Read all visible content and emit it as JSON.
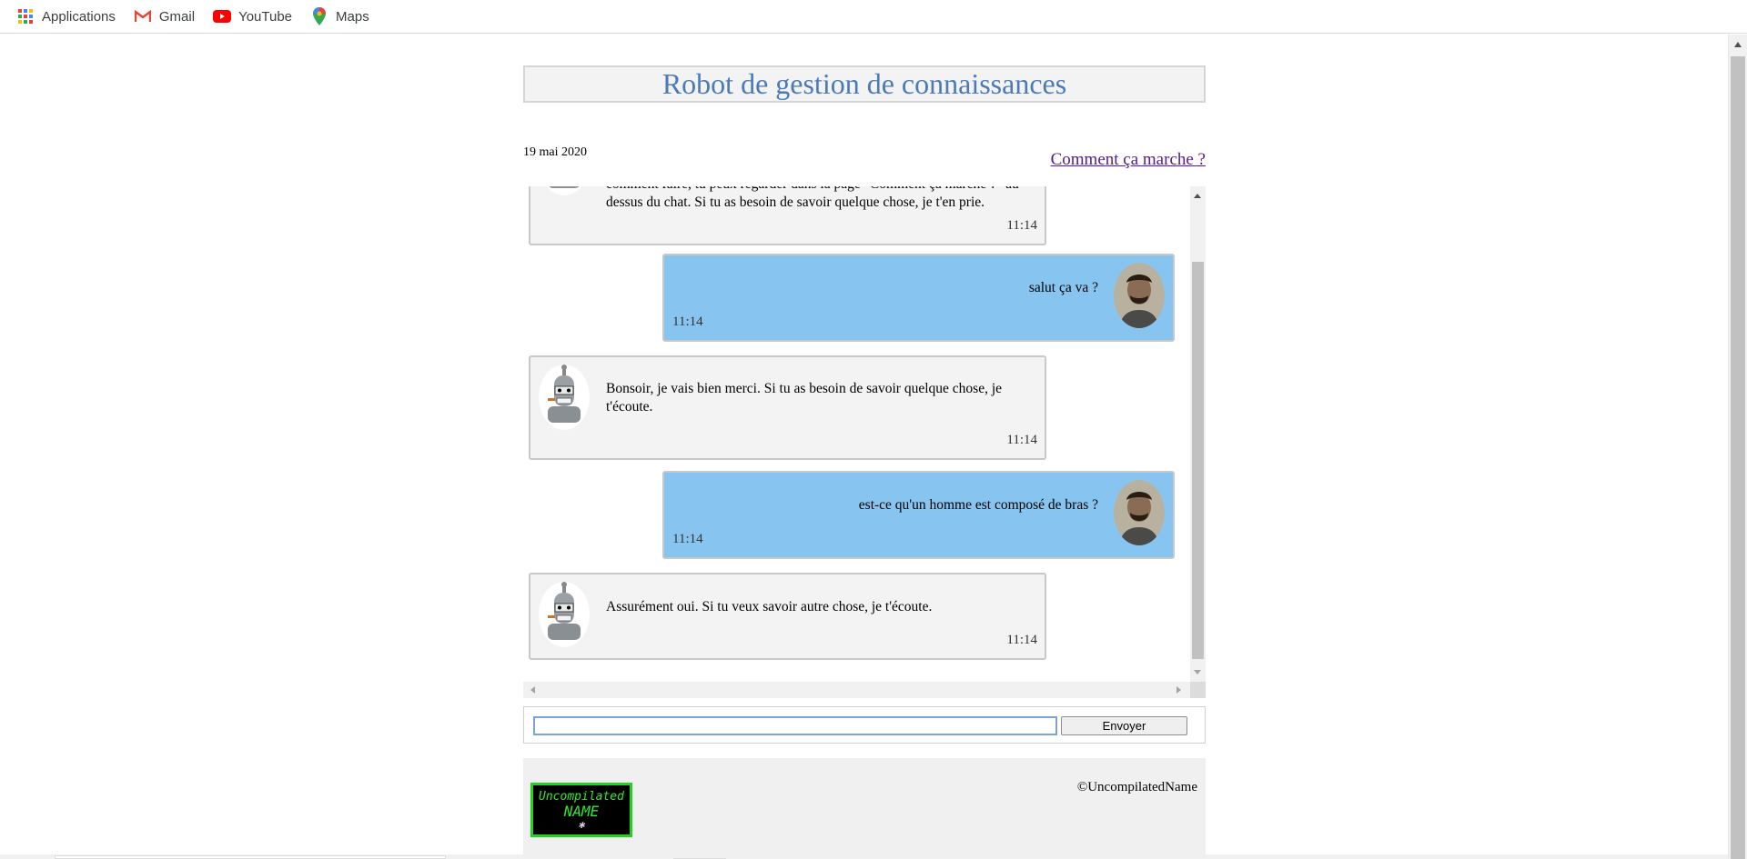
{
  "bookmarks": [
    {
      "label": "Applications",
      "icon": "apps-grid-icon"
    },
    {
      "label": "Gmail",
      "icon": "gmail-icon"
    },
    {
      "label": "YouTube",
      "icon": "youtube-icon"
    },
    {
      "label": "Maps",
      "icon": "maps-pin-icon"
    }
  ],
  "header": {
    "title": "Robot de gestion de connaissances",
    "date": "19 mai 2020",
    "help_link": "Comment ça marche ?"
  },
  "chat": {
    "messages": [
      {
        "sender": "bot",
        "text": "comment faire, tu peux regarder dans la page \"Comment ça marche ?\" au dessus du chat. Si tu as besoin de savoir quelque chose, je t'en prie.",
        "time": "11:14"
      },
      {
        "sender": "user",
        "text": "salut ça va ?",
        "time": "11:14"
      },
      {
        "sender": "bot",
        "text": "Bonsoir, je vais bien merci. Si tu as besoin de savoir quelque chose, je t'écoute.",
        "time": "11:14"
      },
      {
        "sender": "user",
        "text": "est-ce qu'un homme est composé de bras ?",
        "time": "11:14"
      },
      {
        "sender": "bot",
        "text": "Assurément oui. Si tu veux savoir autre chose, je t'écoute.",
        "time": "11:14"
      }
    ]
  },
  "form": {
    "input_value": "",
    "send_label": "Envoyer"
  },
  "footer": {
    "logo_line1": "Uncompilated",
    "logo_line2": "NAME",
    "copyright": "©UncompilatedName"
  },
  "colors": {
    "title": "#4a7ab8",
    "bot_bubble": "#f3f3f3",
    "user_bubble": "#87c5f0",
    "link": "#551a8b",
    "logo_green": "#1fd31f"
  }
}
